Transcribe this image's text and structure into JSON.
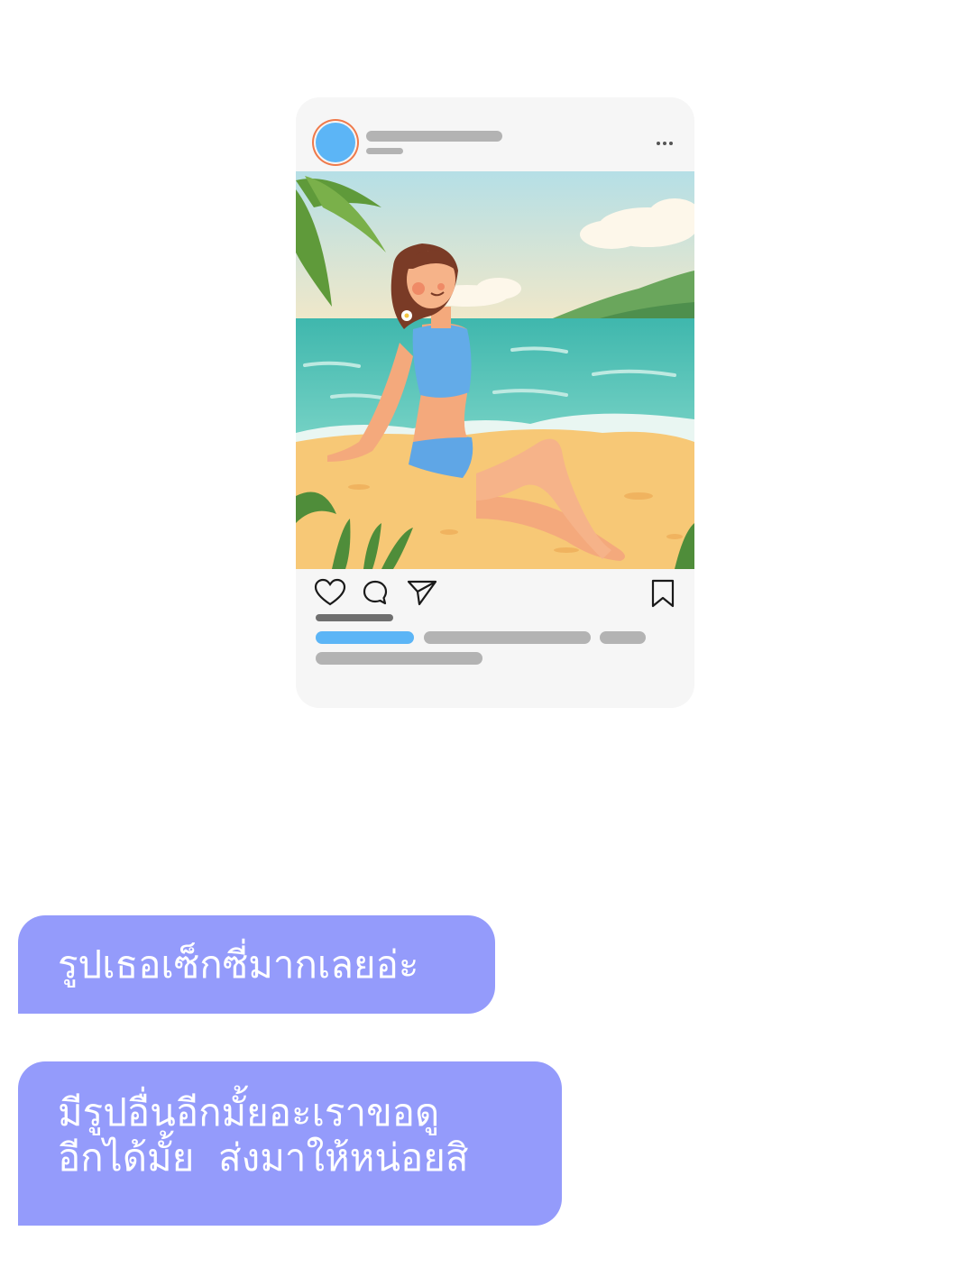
{
  "post": {
    "avatar_color": "#5cb5f6",
    "avatar_ring_color": "#ef7a4b",
    "placeholder_bar_color": "#b3b3b3",
    "link_bar_color": "#5cb5f6",
    "more_icon": "more-horizontal-icon",
    "photo_description": "beach-illustration",
    "actions": [
      "heart-icon",
      "comment-icon",
      "share-icon",
      "bookmark-icon"
    ]
  },
  "messages": [
    {
      "text": "รูปเธอเซ็กซี่มากเลยอ่ะ"
    },
    {
      "text": "มีรูปอื่นอีกมั้ยอะเราขอดู\nอีกได้มั้ย  ส่งมาให้หน่อยสิ"
    }
  ],
  "colors": {
    "bubble": "#949bfb",
    "bubble_text": "#ffffff",
    "card_background": "#f6f6f6"
  }
}
